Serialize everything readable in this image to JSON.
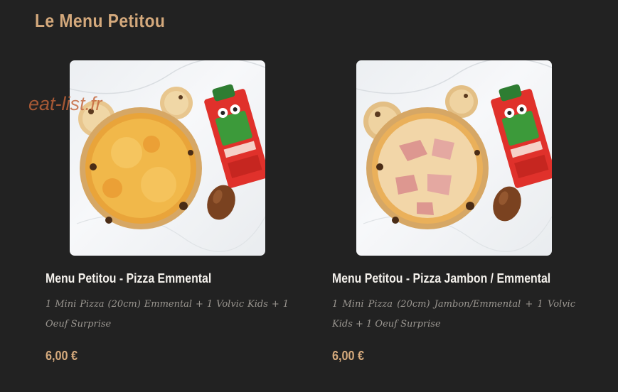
{
  "page": {
    "title": "Le Menu Petitou",
    "watermark": "eat-list.fr"
  },
  "items": [
    {
      "name": "Menu Petitou - Pizza Emmental",
      "description": "1 Mini Pizza (20cm) Emmental + 1 Volvic Kids + 1 Oeuf Surprise",
      "price": "6,00 €",
      "image_alt": "Mini pizza emmental, Volvic Kids bottle and chocolate egg"
    },
    {
      "name": "Menu Petitou - Pizza Jambon / Emmental",
      "description": "1 Mini Pizza (20cm) Jambon/Emmental + 1 Volvic Kids + 1 Oeuf Surprise",
      "price": "6,00 €",
      "image_alt": "Mini pizza jambon emmental, Volvic Kids bottle and chocolate egg"
    }
  ],
  "colors": {
    "background": "#222222",
    "accent": "#d4a97c",
    "text": "#f4f1ec",
    "muted": "#9a9690",
    "watermark": "#c4653a"
  }
}
